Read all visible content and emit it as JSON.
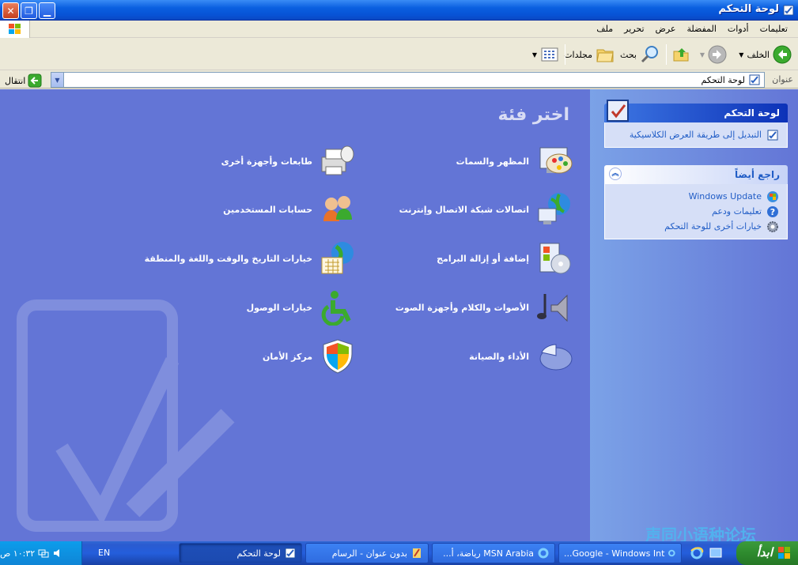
{
  "window": {
    "title": "لوحة التحكم"
  },
  "menu": [
    "ملف",
    "تحرير",
    "عرض",
    "المفضلة",
    "أدوات",
    "تعليمات"
  ],
  "toolbar": {
    "back": "الخلف",
    "search": "بحث",
    "folders": "مجلدات"
  },
  "address": {
    "label": "عنوان",
    "value": "لوحة التحكم",
    "go": "انتقال"
  },
  "sidebar": {
    "panel1": {
      "title": "لوحة التحكم",
      "link": "التبديل إلى طريقة العرض الكلاسيكية"
    },
    "panel2": {
      "title": "راجع أيضاً",
      "links": [
        "Windows Update",
        "تعليمات ودعم",
        "خيارات أخرى للوحة التحكم"
      ]
    }
  },
  "main": {
    "heading": "اختر فئة",
    "categories": [
      "المظهر والسمات",
      "طابعات وأجهزة أخرى",
      "اتصالات شبكة الاتصال وإنترنت",
      "حسابات المستخدمين",
      "إضافة أو إزالة البرامج",
      "خيارات التاريخ والوقت واللغة والمنطقة",
      "الأصوات والكلام وأجهزة الصوت",
      "خيارات الوصول",
      "الأداء والصيانة",
      "مركز الأمان"
    ]
  },
  "watermark": "声同小语种论坛",
  "taskbar": {
    "start": "ابدأ",
    "tasks": [
      "لوحة التحكم",
      "بدون عنوان - الرسام",
      "MSN Arabia رياضة، أ...",
      "Google - Windows Int..."
    ],
    "lang": "EN",
    "clock": "١٠:٣٢ ص"
  }
}
